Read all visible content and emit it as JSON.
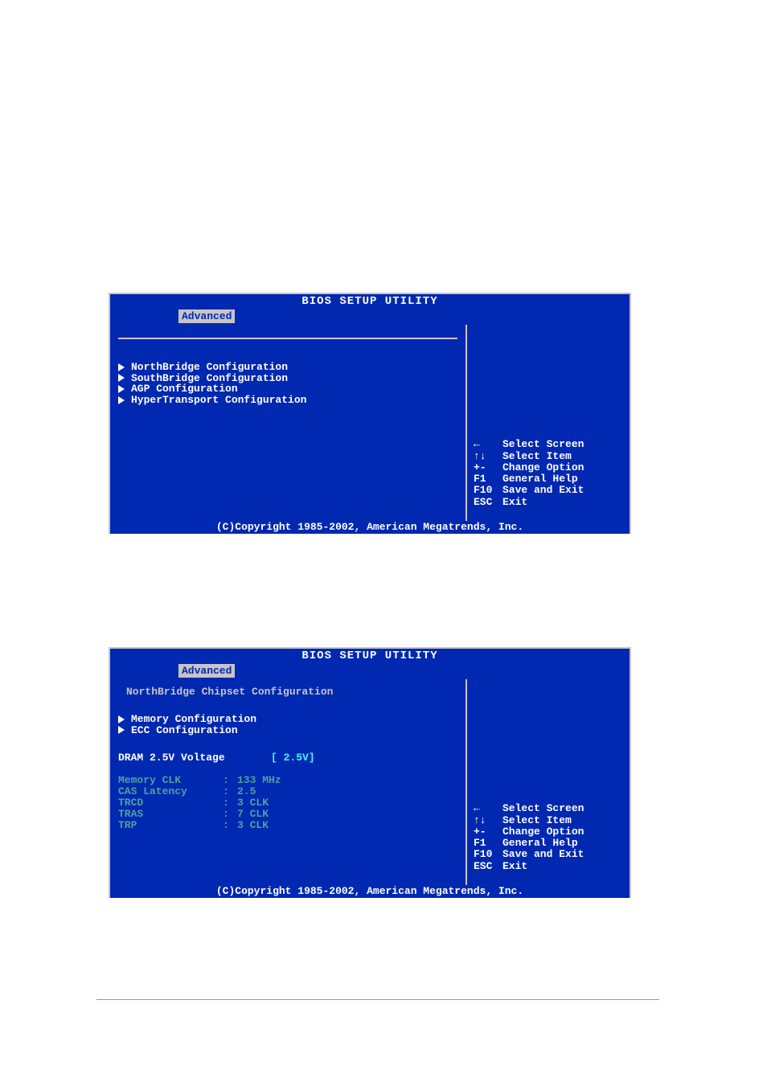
{
  "bios": {
    "title": "BIOS SETUP UTILITY",
    "tab": "Advanced",
    "footer": "(C)Copyright 1985-2002, American Megatrends, Inc."
  },
  "top_menu": {
    "items": [
      "NorthBridge Configuration",
      "SouthBridge Configuration",
      "AGP Configuration",
      "HyperTransport Configuration"
    ]
  },
  "bottom_menu": {
    "heading": "NorthBridge Chipset Configuration",
    "items": [
      "Memory Configuration",
      "ECC Configuration"
    ],
    "option": {
      "label": "DRAM 2.5V Voltage",
      "value": "[  2.5V]"
    },
    "readonly": [
      {
        "k": "Memory CLK",
        "v": "133 MHz"
      },
      {
        "k": "CAS Latency",
        "v": "2.5"
      },
      {
        "k": "TRCD",
        "v": "3 CLK"
      },
      {
        "k": "TRAS",
        "v": "7 CLK"
      },
      {
        "k": "TRP",
        "v": "3 CLK"
      }
    ]
  },
  "help": [
    {
      "key": "←",
      "label": "Select Screen"
    },
    {
      "key": "↑↓",
      "label": "Select Item"
    },
    {
      "key": "+-",
      "label": "Change Option"
    },
    {
      "key": "F1",
      "label": "General Help"
    },
    {
      "key": "F10",
      "label": "Save and Exit"
    },
    {
      "key": "ESC",
      "label": "Exit"
    }
  ]
}
